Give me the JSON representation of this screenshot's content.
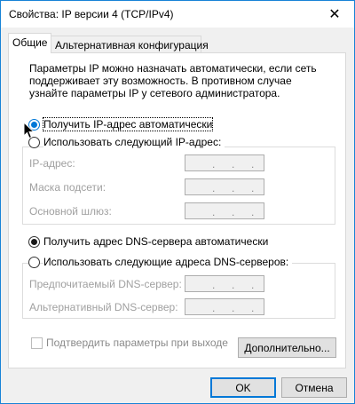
{
  "window": {
    "title": "Свойства: IP версии 4 (TCP/IPv4)",
    "close_symbol": "✕"
  },
  "tabs": [
    {
      "label": "Общие",
      "active": true
    },
    {
      "label": "Альтернативная конфигурация",
      "active": false
    }
  ],
  "intro_text": "Параметры IP можно назначать автоматически, если сеть поддерживает эту возможность. В противном случае узнайте параметры IP у сетевого администратора.",
  "ip_section": {
    "auto_label": "Получить IP-адрес автоматически",
    "auto_selected": true,
    "manual_label": "Использовать следующий IP-адрес:",
    "fields": [
      {
        "label": "IP-адрес:",
        "value": ". . ."
      },
      {
        "label": "Маска подсети:",
        "value": ". . ."
      },
      {
        "label": "Основной шлюз:",
        "value": ". . ."
      }
    ]
  },
  "dns_section": {
    "auto_label": "Получить адрес DNS-сервера автоматически",
    "auto_selected": true,
    "manual_label": "Использовать следующие адреса DNS-серверов:",
    "fields": [
      {
        "label": "Предпочитаемый DNS-сервер:",
        "value": ". . ."
      },
      {
        "label": "Альтернативный DNS-сервер:",
        "value": ". . ."
      }
    ]
  },
  "validate_label": "Подтвердить параметры при выходе",
  "buttons": {
    "advanced": "Дополнительно...",
    "ok": "OK",
    "cancel": "Отмена"
  },
  "colors": {
    "accent": "#0078d7",
    "window_border": "#1883d7"
  }
}
